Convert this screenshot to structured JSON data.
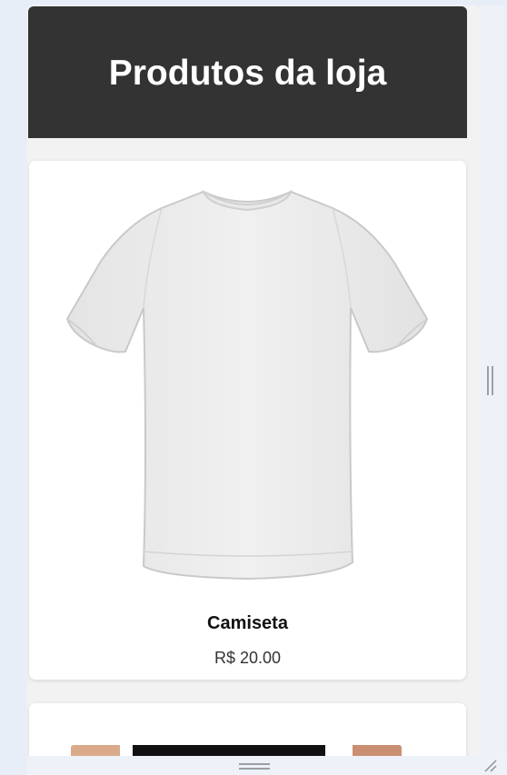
{
  "header": {
    "title": "Produtos da loja"
  },
  "products": [
    {
      "image_icon": "white-tshirt-image",
      "name": "Camiseta",
      "price": "R$ 20.00"
    },
    {
      "image_icon": "product-image-partial"
    }
  ],
  "colors": {
    "header_bg": "#333333",
    "page_bg": "#f2f2f2",
    "card_bg": "#ffffff"
  }
}
